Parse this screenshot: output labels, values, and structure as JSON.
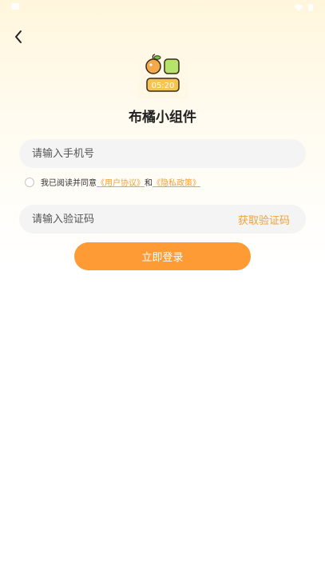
{
  "app": {
    "name": "布橘小组件",
    "logo_time": "05:20"
  },
  "phone": {
    "placeholder": "请输入手机号"
  },
  "agreement": {
    "prefix": "我已阅读并同意",
    "user_agreement": "《用户协议》",
    "connector": "和",
    "privacy_policy": "《隐私政策》"
  },
  "code": {
    "placeholder": "请输入验证码",
    "get_code_label": "获取验证码"
  },
  "login": {
    "label": "立即登录"
  },
  "colors": {
    "accent": "#fe9b35",
    "link": "#f0a03c",
    "field_bg": "#f4f4f4"
  }
}
